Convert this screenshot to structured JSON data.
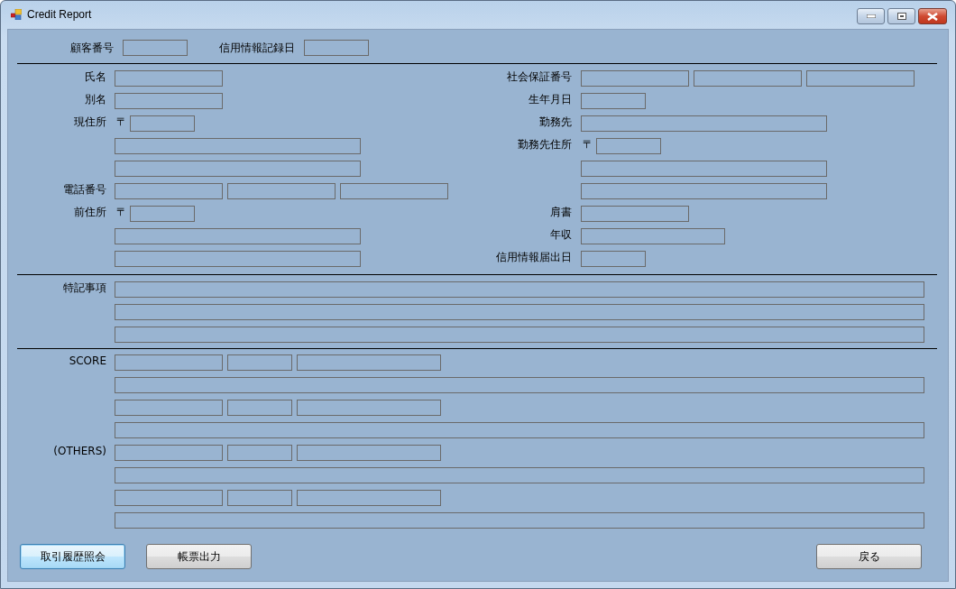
{
  "window": {
    "title": "Credit Report"
  },
  "header": [
    {
      "label": "顧客番号",
      "fields": [
        {
          "kind": "short"
        }
      ]
    },
    {
      "label": "信用情報記録日",
      "fields": [
        {
          "kind": "short"
        }
      ]
    }
  ],
  "left_rows": [
    {
      "label": "氏名",
      "fields": [
        {
          "kind": "medium"
        }
      ]
    },
    {
      "label": "別名",
      "fields": [
        {
          "kind": "medium"
        }
      ]
    },
    {
      "label": "現住所",
      "prefix": "〒",
      "fields": [
        {
          "kind": "short"
        }
      ]
    },
    {
      "fields": [
        {
          "kind": "long"
        }
      ]
    },
    {
      "fields": [
        {
          "kind": "long"
        }
      ]
    },
    {
      "label": "電話番号",
      "fields": [
        {
          "kind": "medium"
        },
        {
          "kind": "medium"
        },
        {
          "kind": "medium"
        }
      ]
    },
    {
      "label": "前住所",
      "prefix": "〒",
      "fields": [
        {
          "kind": "short"
        }
      ]
    },
    {
      "fields": [
        {
          "kind": "long"
        }
      ]
    },
    {
      "fields": [
        {
          "kind": "long"
        }
      ]
    }
  ],
  "right_rows": [
    {
      "label": "社会保証番号",
      "fields": [
        {
          "kind": "medium"
        },
        {
          "kind": "medium"
        },
        {
          "kind": "medium"
        }
      ]
    },
    {
      "label": "生年月日",
      "fields": [
        {
          "kind": "short"
        }
      ]
    },
    {
      "label": "勤務先",
      "fields": [
        {
          "kind": "long"
        }
      ]
    },
    {
      "label": "勤務先住所",
      "prefix": "〒",
      "fields": [
        {
          "kind": "short"
        }
      ]
    },
    {
      "fields": [
        {
          "kind": "long"
        }
      ]
    },
    {
      "fields": [
        {
          "kind": "long"
        }
      ]
    },
    {
      "label": "肩書",
      "fields": [
        {
          "kind": "medium"
        }
      ]
    },
    {
      "label": "年収",
      "fields": [
        {
          "kind": "wide"
        }
      ]
    },
    {
      "label": "信用情報届出日",
      "fields": [
        {
          "kind": "short"
        }
      ]
    }
  ],
  "notes_rows": [
    {
      "label": "特記事項",
      "fields": [
        {
          "kind": "full"
        }
      ]
    },
    {
      "fields": [
        {
          "kind": "full"
        }
      ]
    },
    {
      "fields": [
        {
          "kind": "full"
        }
      ]
    }
  ],
  "score_rows": [
    {
      "label": "SCORE",
      "fields": [
        {
          "kind": "medium"
        },
        {
          "kind": "short"
        },
        {
          "kind": "wide"
        }
      ]
    },
    {
      "fields": [
        {
          "kind": "full"
        }
      ]
    },
    {
      "fields": [
        {
          "kind": "medium"
        },
        {
          "kind": "short"
        },
        {
          "kind": "wide"
        }
      ]
    },
    {
      "fields": [
        {
          "kind": "full"
        }
      ]
    },
    {
      "label": "(OTHERS)",
      "fields": [
        {
          "kind": "medium"
        },
        {
          "kind": "short"
        },
        {
          "kind": "wide"
        }
      ]
    },
    {
      "fields": [
        {
          "kind": "full"
        }
      ]
    },
    {
      "fields": [
        {
          "kind": "medium"
        },
        {
          "kind": "short"
        },
        {
          "kind": "wide"
        }
      ]
    },
    {
      "fields": [
        {
          "kind": "full"
        }
      ]
    }
  ],
  "buttons": [
    {
      "label": "取引履歴照会",
      "focused": true
    },
    {
      "label": "帳票出力",
      "focused": false
    },
    {
      "label": "戻る",
      "focused": false
    }
  ]
}
